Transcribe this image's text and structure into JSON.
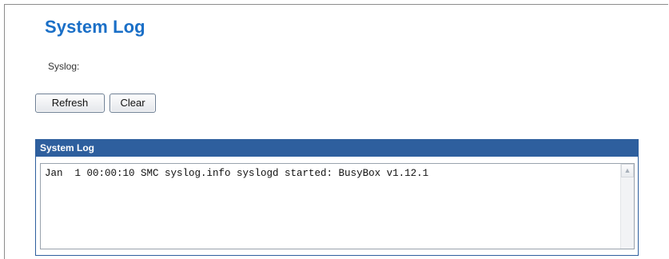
{
  "page": {
    "title": "System Log",
    "syslog_label": "Syslog:"
  },
  "buttons": {
    "refresh_label": "Refresh",
    "clear_label": "Clear"
  },
  "log_panel": {
    "header": "System Log",
    "lines": [
      "Jan  1 00:00:10 SMC syslog.info syslogd started: BusyBox v1.12.1"
    ],
    "scroll_up_icon": "chevron-up-icon"
  },
  "colors": {
    "title": "#1a6fc7",
    "panel_header_bg": "#2e5f9e"
  }
}
